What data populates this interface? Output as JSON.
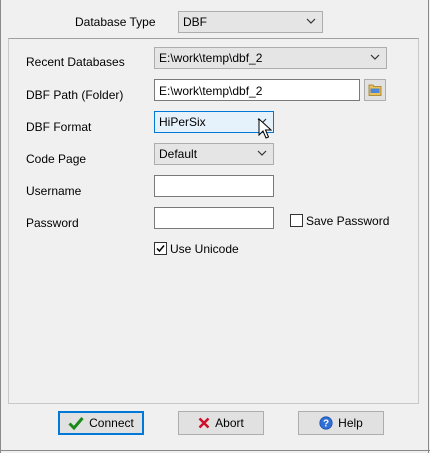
{
  "db_type": {
    "label": "Database Type",
    "value": "DBF"
  },
  "form": {
    "recent_databases": {
      "label": "Recent Databases",
      "value": "E:\\work\\temp\\dbf_2"
    },
    "dbf_path": {
      "label": "DBF Path (Folder)",
      "value": "E:\\work\\temp\\dbf_2"
    },
    "dbf_format": {
      "label": "DBF Format",
      "value": "HiPerSix"
    },
    "code_page": {
      "label": "Code Page",
      "value": "Default"
    },
    "username": {
      "label": "Username",
      "value": ""
    },
    "password": {
      "label": "Password",
      "value": ""
    },
    "save_password": {
      "label": "Save Password",
      "checked": false
    },
    "use_unicode": {
      "label": "Use Unicode",
      "checked": true
    }
  },
  "buttons": {
    "connect": "Connect",
    "abort": "Abort",
    "help": "Help"
  },
  "colors": {
    "focus": "#0078d7",
    "abort_x": "#d0102a",
    "check_green": "#1a8a1a",
    "help_blue": "#2f6fd6"
  },
  "icons": {
    "browse": "folder-browse-icon",
    "connect": "check-icon",
    "abort": "x-icon",
    "help": "help-icon",
    "cursor": "mouse-pointer-icon"
  }
}
